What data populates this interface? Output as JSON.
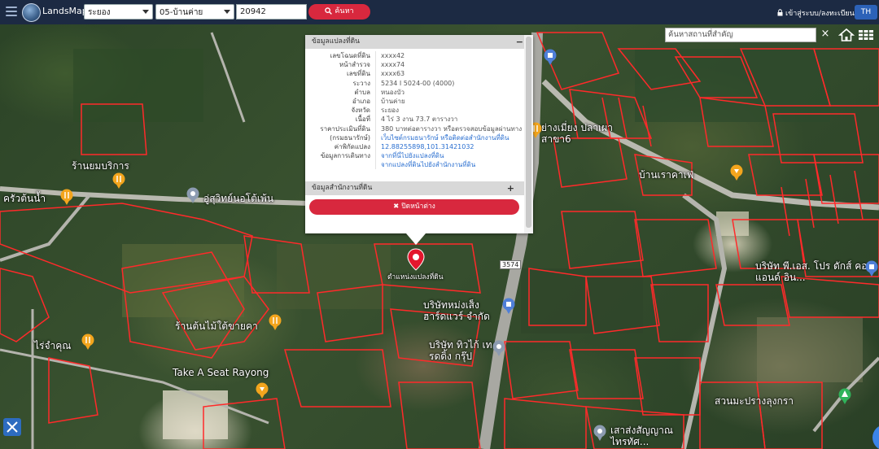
{
  "topbar": {
    "brand": "LandsMaps",
    "province_select": "ระยอง",
    "district_select": "05-บ้านค่าย",
    "parcel_number": "20942",
    "search_label": "ค้นหา",
    "login_label": "เข้าสู่ระบบ/ลงทะเบียน",
    "lang_label": "TH"
  },
  "poi_search": {
    "placeholder": "ค้นหาสถานที่สำคัญ",
    "clear": "×"
  },
  "popup": {
    "section1_title": "ข้อมูลแปลงที่ดิน",
    "section1_toggle": "−",
    "rows": [
      {
        "k": "เลขโฉนดที่ดิน",
        "v": "xxxx42"
      },
      {
        "k": "หน้าสำรวจ",
        "v": "xxxx74"
      },
      {
        "k": "เลขที่ดิน",
        "v": "xxxx63"
      },
      {
        "k": "ระวาง",
        "v": "5234 I 5024-00 (4000)"
      },
      {
        "k": "ตำบล",
        "v": "หนองบัว"
      },
      {
        "k": "อำเภอ",
        "v": "บ้านค่าย"
      },
      {
        "k": "จังหวัด",
        "v": "ระยอง"
      },
      {
        "k": "เนื้อที่",
        "v": "4 ไร่ 3 งาน 73.7 ตารางวา"
      },
      {
        "k": "ราคาประเมินที่ดิน",
        "v": "380 บาทต่อตารางวา หรือตรวจสอบข้อมูลผ่านทาง"
      },
      {
        "k": "(กรมธนารักษ์)",
        "v": "เว็บไซต์กรมธนารักษ์ หรือติดต่อสำนักงานที่ดิน"
      },
      {
        "k": "ค่าพิกัดแปลง",
        "v": "12.88255898,101.31421032"
      },
      {
        "k": "ข้อมูลการเดินทาง",
        "v": "จากที่นี่ไปยังแปลงที่ดิน"
      },
      {
        "k": "",
        "v": "จากแปลงที่ดินไปยังสำนักงานที่ดิน"
      }
    ],
    "section2_title": "ข้อมูลสำนักงานที่ดิน",
    "section2_toggle": "+",
    "close_label": "ปิดหน้าต่าง"
  },
  "map_labels": {
    "marker_label": "ตำแหน่งแปลงที่ดิน",
    "road_number": "3574",
    "places": [
      "ร้านยมบริการ",
      "ครัวต้นน้ำ",
      "อู่สุวิทย์นอโต้เพ้น",
      "ร้านต้นไม้ใต้ขายคา",
      "ไร่จำคุณ",
      "Take A Seat Rayong",
      "บริษัทหม่งเส็ง ฮาร์ดแวร์ จำกัด",
      "บริษัท ทิวไก้ เทรดดิ้ง กรุ๊ป",
      "ย่างเมี่ยง ปลาเผา สาขา6",
      "บ้านเราคาเฟ่",
      "บริษัท พี.เอส. โปร ดักส์ คอน แอนด์ อิน...",
      "สวนมะปรางลุงกรา",
      "เสาส่งสัญญาณ ไทรทัศ..."
    ]
  },
  "colors": {
    "topbar": "#1c2a43",
    "accent_red": "#d8283e",
    "lang_blue": "#2c62b8",
    "parcel_red": "#ff2a2a"
  },
  "icons": [
    "menu-icon",
    "search-icon",
    "lock-icon",
    "home-icon",
    "grid-icon",
    "tools-icon",
    "map-pin-icon"
  ]
}
